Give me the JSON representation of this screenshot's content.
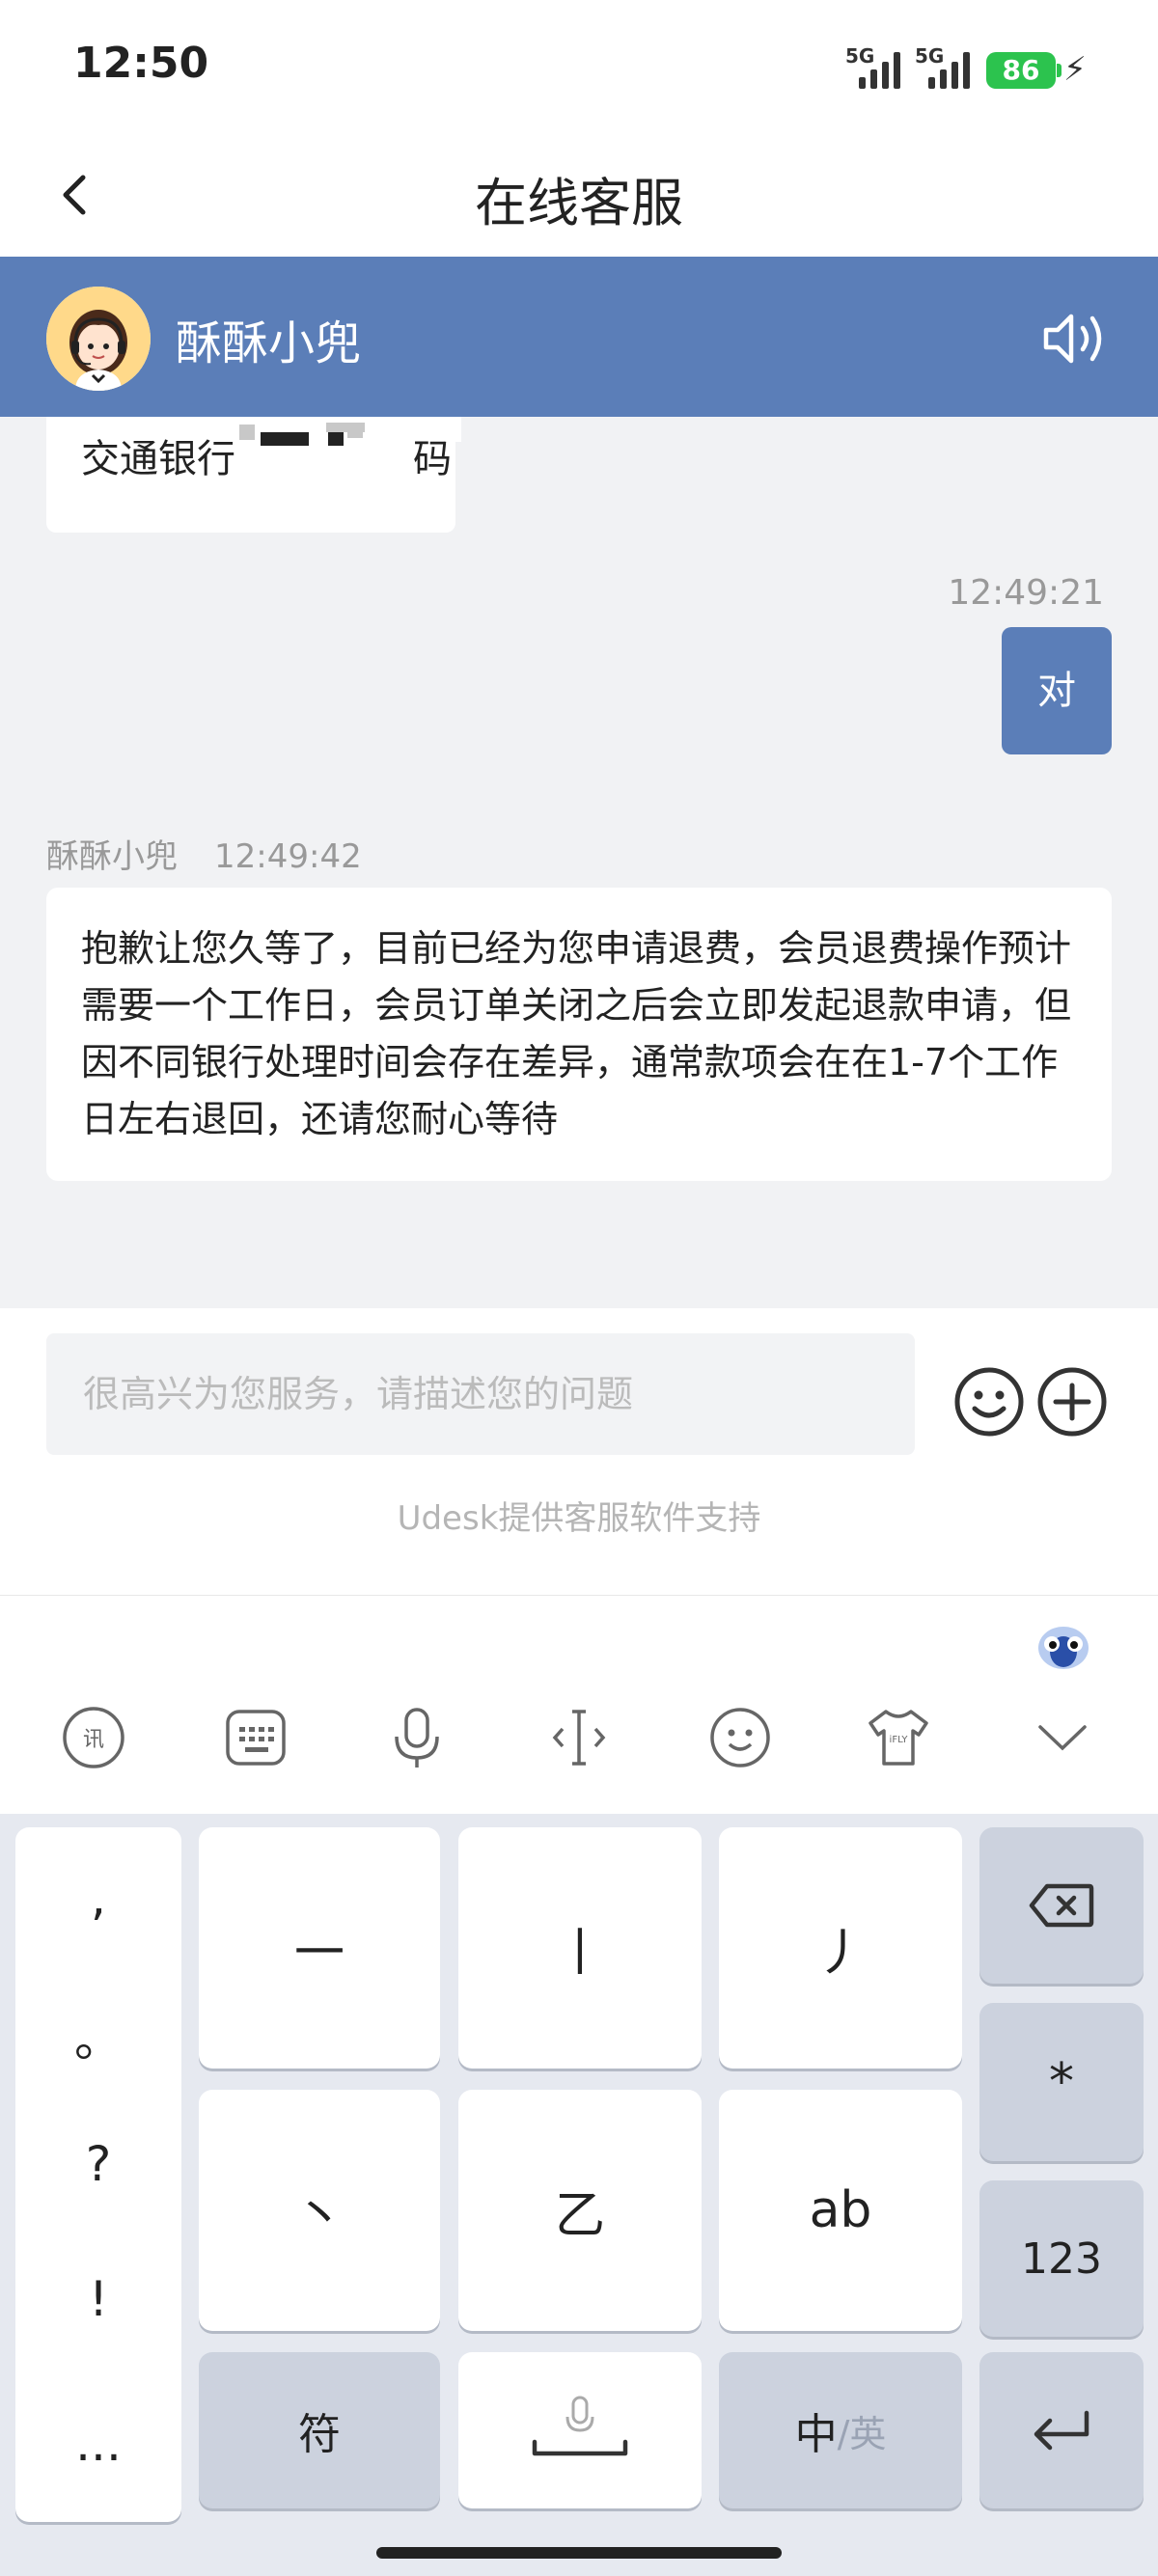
{
  "status_bar": {
    "time": "12:50",
    "signal1": "5G",
    "signal2": "5G",
    "battery": "86"
  },
  "header": {
    "title": "在线客服"
  },
  "agent": {
    "name": "酥酥小兜"
  },
  "chat": {
    "partial_message": "交通银行",
    "partial_message_tail": "码",
    "user_time": "12:49:21",
    "user_message": "对",
    "agent_sender": "酥酥小兜",
    "agent_time": "12:49:42",
    "agent_message": "抱歉让您久等了，目前已经为您申请退费，会员退费操作预计需要一个工作日，会员订单关闭之后会立即发起退款申请，但因不同银行处理时间会存在差异，通常款项会在在1-7个工作日左右退回，还请您耐心等待"
  },
  "input": {
    "placeholder": "很高兴为您服务，请描述您的问题",
    "powered_by": "Udesk提供客服软件支持"
  },
  "keyboard": {
    "punctuation": [
      ",",
      "。",
      "?",
      "!",
      "..."
    ],
    "keys": {
      "k1": "一",
      "k2": "丨",
      "k3": "丿",
      "k4": "丶",
      "k5": "乙",
      "k6": "ab",
      "star": "*",
      "num": "123",
      "symbol": "符",
      "lang_main": "中",
      "lang_sub": "/英"
    }
  },
  "icons": [
    "back-icon",
    "headset-avatar",
    "speaker-icon",
    "emoji-icon",
    "plus-icon",
    "voice-input-icon",
    "keyboard-icon",
    "mic-icon",
    "cursor-icon",
    "smile-icon",
    "skin-icon",
    "collapse-icon",
    "backspace-icon",
    "enter-icon",
    "space-icon"
  ],
  "colors": {
    "accent": "#5b7eb8",
    "battery": "#2cc34e"
  }
}
